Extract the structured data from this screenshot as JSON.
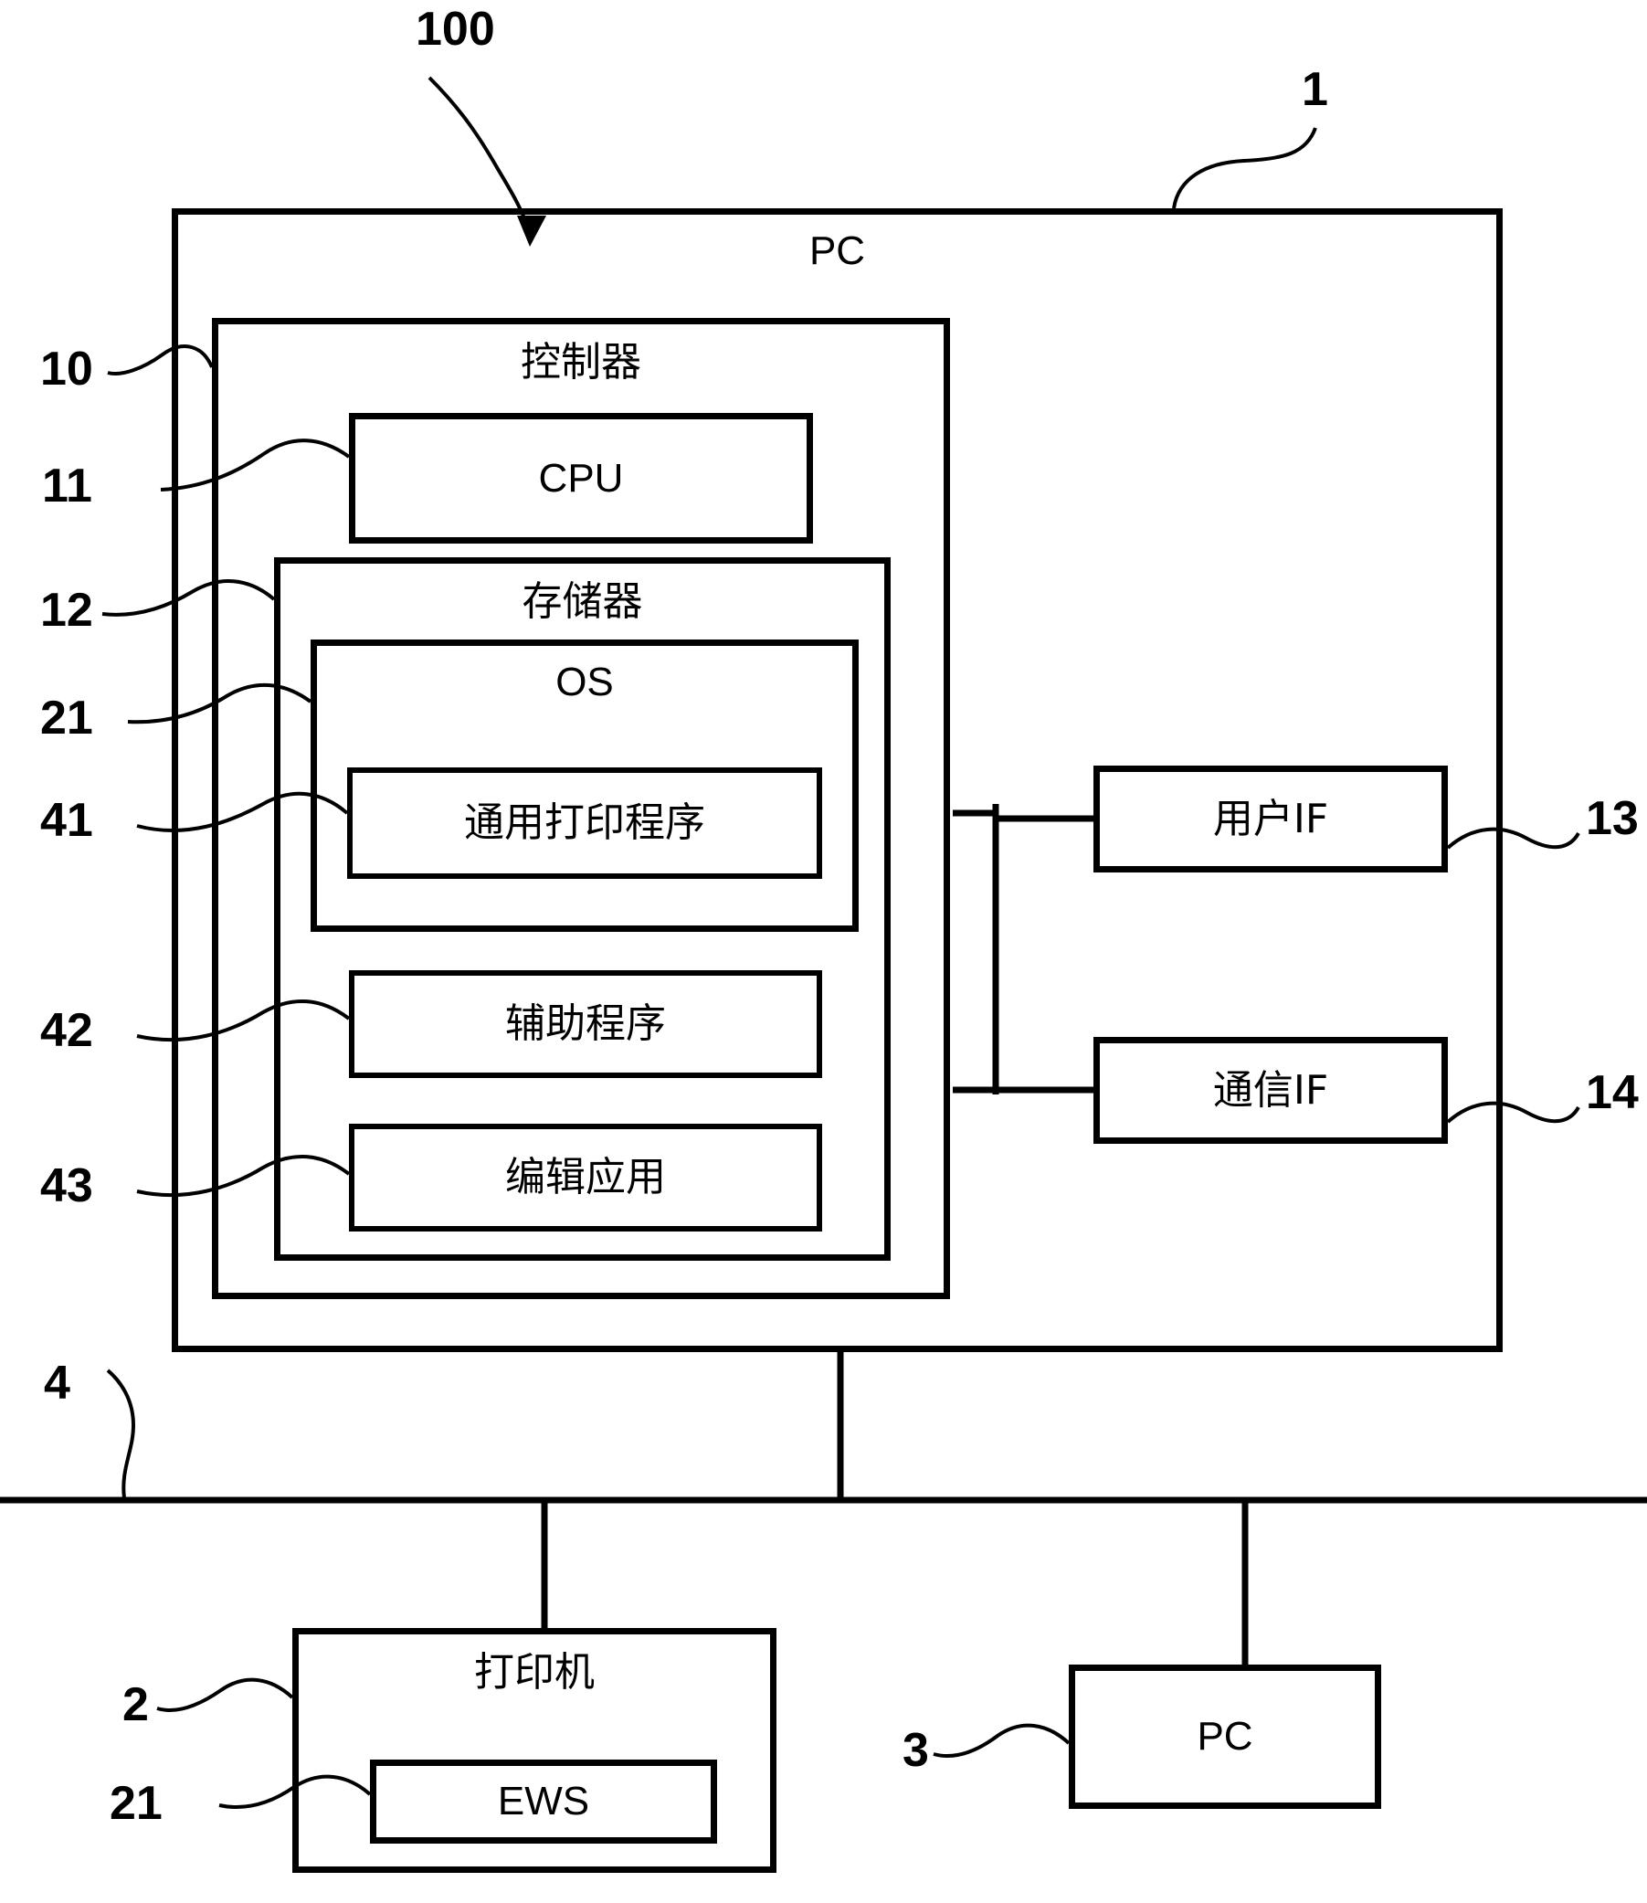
{
  "figure": {
    "type": "patent-block-diagram",
    "system_ref": "100",
    "background": "#ffffff",
    "line_color": "#000000"
  },
  "blocks": {
    "pc_main": {
      "label": "PC",
      "ref": "1"
    },
    "controller": {
      "label": "控制器",
      "ref": "10"
    },
    "cpu": {
      "label": "CPU",
      "ref": "11"
    },
    "memory": {
      "label": "存储器",
      "ref": "12"
    },
    "os": {
      "label": "OS",
      "ref": "21"
    },
    "universal_print_program": {
      "label": "通用打印程序",
      "ref": "41"
    },
    "helper_program": {
      "label": "辅助程序",
      "ref": "42"
    },
    "editing_application": {
      "label": "编辑应用",
      "ref": "43"
    },
    "user_if": {
      "label": "用户IF",
      "ref": "13"
    },
    "comm_if": {
      "label": "通信IF",
      "ref": "14"
    },
    "network": {
      "ref": "4"
    },
    "printer": {
      "label": "打印机",
      "ref": "2"
    },
    "ews": {
      "label": "EWS",
      "ref": "21"
    },
    "pc_remote": {
      "label": "PC",
      "ref": "3"
    }
  }
}
